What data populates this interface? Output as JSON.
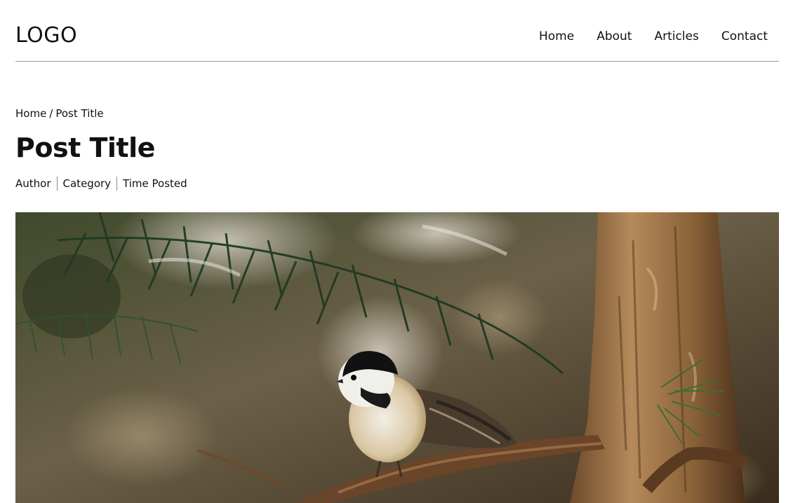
{
  "header": {
    "logo": "LOGO",
    "nav": [
      "Home",
      "About",
      "Articles",
      "Contact"
    ]
  },
  "breadcrumb": {
    "home": "Home",
    "separator": "/",
    "current": "Post Title"
  },
  "post": {
    "title": "Post Title",
    "meta": {
      "author": "Author",
      "category": "Category",
      "time": "Time Posted"
    },
    "hero_image": "bird-on-pine-branch"
  }
}
